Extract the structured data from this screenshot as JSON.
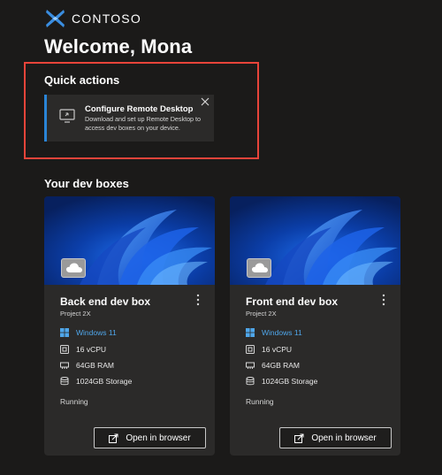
{
  "brand": {
    "name": "CONTOSO",
    "logo_icon": "contoso-logo-icon"
  },
  "header": {
    "welcome": "Welcome, Mona"
  },
  "quick_actions": {
    "title": "Quick actions",
    "card": {
      "title": "Configure Remote Desktop",
      "description": "Download and set up Remote Desktop to access dev boxes on your device.",
      "icon": "remote-desktop-icon",
      "close_icon": "close-icon"
    }
  },
  "dev_boxes": {
    "title": "Your dev boxes",
    "items": [
      {
        "name": "Back end dev box",
        "project": "Project 2X",
        "os": "Windows 11",
        "cpu": "16 vCPU",
        "ram": "64GB RAM",
        "storage": "1024GB Storage",
        "status": "Running",
        "action": "Open in browser"
      },
      {
        "name": "Front end dev box",
        "project": "Project 2X",
        "os": "Windows 11",
        "cpu": "16 vCPU",
        "ram": "64GB RAM",
        "storage": "1024GB Storage",
        "status": "Running",
        "action": "Open in browser"
      }
    ]
  },
  "colors": {
    "background": "#1b1a19",
    "card": "#2b2a29",
    "accent": "#2a84d6",
    "os_link": "#4fa6ea",
    "highlight": "#e8443a"
  }
}
